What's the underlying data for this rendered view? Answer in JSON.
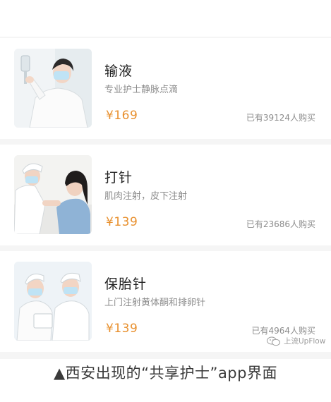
{
  "services": [
    {
      "title": "输液",
      "description": "专业护士静脉点滴",
      "price": "¥169",
      "sold": "已有39124人购买",
      "image_icon": "nurse-iv-drip-photo"
    },
    {
      "title": "打针",
      "description": "肌肉注射，皮下注射",
      "price": "¥139",
      "sold": "已有23686人购买",
      "image_icon": "nurse-injection-photo"
    },
    {
      "title": "保胎针",
      "description": "上门注射黄体酮和排卵针",
      "price": "¥139",
      "sold": "已有4964人购买",
      "image_icon": "nurses-clipboard-photo"
    }
  ],
  "watermark": {
    "text": "上流UpFlow",
    "icon": "wechat-icon"
  },
  "caption": "▲西安出现的“共享护士”app界面",
  "colors": {
    "price": "#e8902e",
    "background": "#f5f5f5",
    "nurse_cap": "#7fb7e6"
  }
}
